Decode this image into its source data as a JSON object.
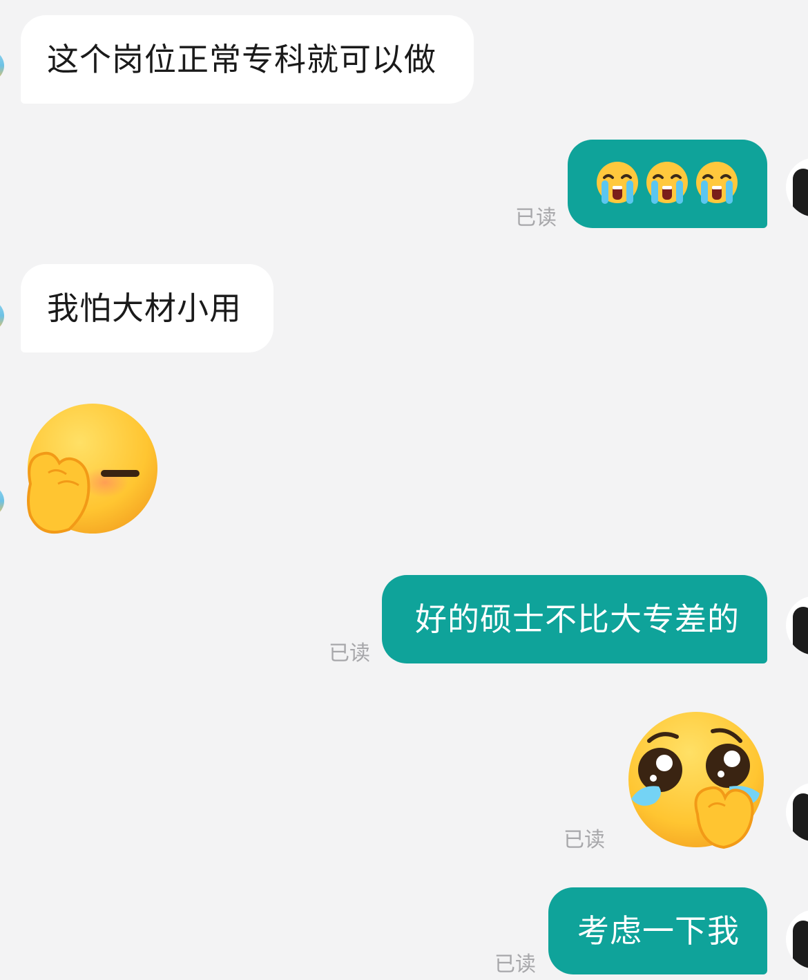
{
  "messages": [
    {
      "id": "m1",
      "text": "这个岗位正常专科就可以做"
    },
    {
      "id": "m2",
      "emojis": [
        "loudly-crying-face",
        "loudly-crying-face",
        "loudly-crying-face"
      ],
      "read": "已读"
    },
    {
      "id": "m3",
      "text": "我怕大材小用"
    },
    {
      "id": "m4",
      "sticker": "face-palm-emoji"
    },
    {
      "id": "m5",
      "text": "好的硕士不比大专差的",
      "read": "已读"
    },
    {
      "id": "m6",
      "sticker": "pleading-teary-face-emoji",
      "read": "已读"
    },
    {
      "id": "m7",
      "text": "考虑一下我",
      "read": "已读"
    }
  ],
  "colors": {
    "background": "#f3f3f4",
    "incoming_bubble": "#ffffff",
    "outgoing_bubble": "#0fa39a",
    "read_receipt": "#a7a7aa"
  }
}
